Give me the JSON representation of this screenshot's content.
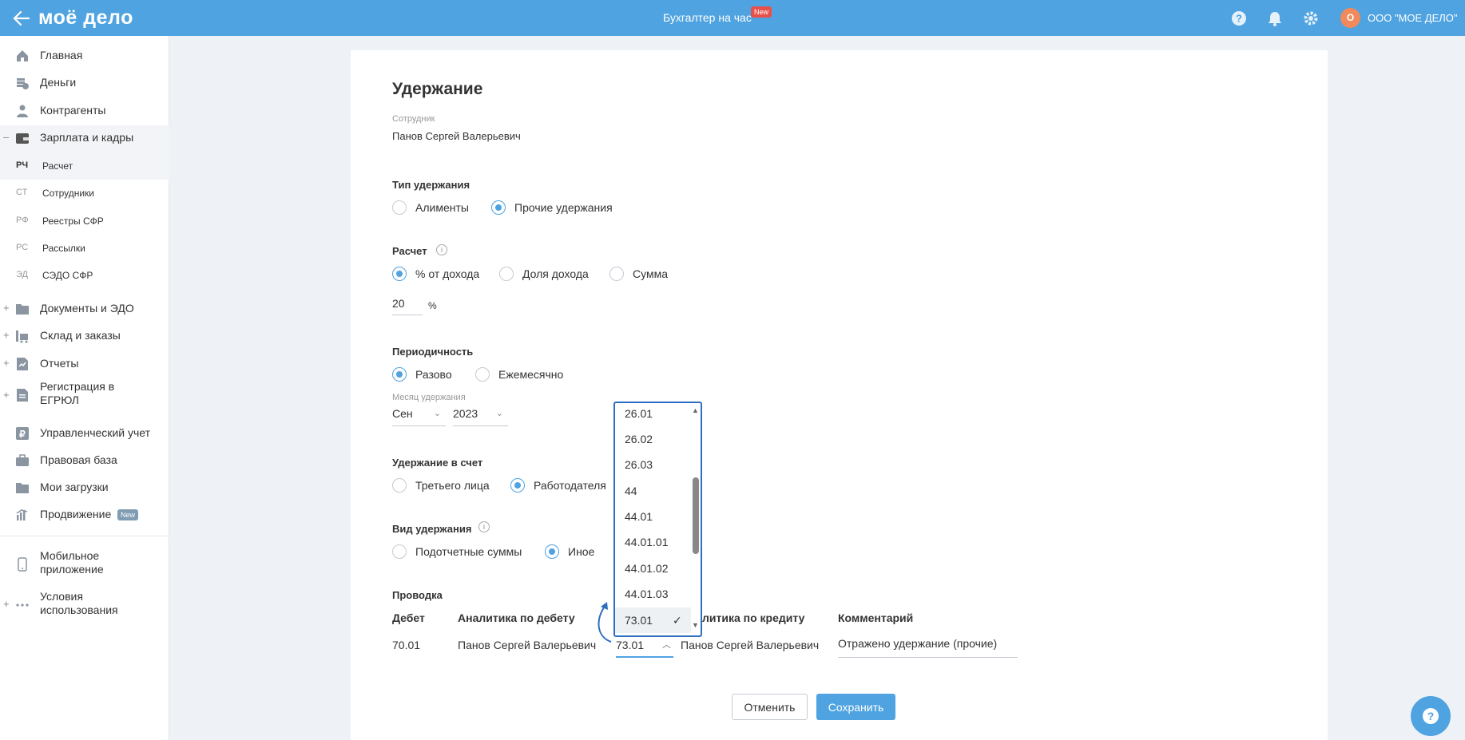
{
  "topbar": {
    "logo": "моё дело",
    "center_title": "Бухгалтер на час",
    "center_badge": "New",
    "org_avatar": "О",
    "org_name": "ООО \"МОЕ ДЕЛО\""
  },
  "sidebar": {
    "items": [
      {
        "label": "Главная",
        "icon": "home-icon"
      },
      {
        "label": "Деньги",
        "icon": "money-icon"
      },
      {
        "label": "Контрагенты",
        "icon": "contractors-icon"
      },
      {
        "label": "Зарплата и кадры",
        "icon": "wallet-icon",
        "toggle": "–"
      },
      {
        "label": "Документы и ЭДО",
        "icon": "folder-icon",
        "toggle": "+"
      },
      {
        "label": "Склад и заказы",
        "icon": "warehouse-icon",
        "toggle": "+"
      },
      {
        "label": "Отчеты",
        "icon": "report-icon",
        "toggle": "+"
      },
      {
        "label": "Регистрация в ЕГРЮЛ",
        "icon": "registration-icon",
        "toggle": "+"
      },
      {
        "label": "Управленческий учет",
        "icon": "management-icon"
      },
      {
        "label": "Правовая база",
        "icon": "briefcase-icon"
      },
      {
        "label": "Мои загрузки",
        "icon": "downloads-icon"
      },
      {
        "label": "Продвижение",
        "icon": "promotion-icon",
        "badge": "New"
      },
      {
        "label": "Мобильное приложение",
        "icon": "mobile-icon"
      },
      {
        "label": "Условия использования",
        "icon": "more-icon",
        "toggle": "+"
      }
    ],
    "subitems": [
      {
        "code": "РЧ",
        "label": "Расчет"
      },
      {
        "code": "СТ",
        "label": "Сотрудники"
      },
      {
        "code": "РФ",
        "label": "Реестры СФР"
      },
      {
        "code": "РС",
        "label": "Рассылки"
      },
      {
        "code": "ЭД",
        "label": "СЭДО СФР"
      }
    ]
  },
  "form": {
    "title": "Удержание",
    "employee_label": "Сотрудник",
    "employee_value": "Панов Сергей Валерьевич",
    "type_title": "Тип удержания",
    "type_options": [
      "Алименты",
      "Прочие удержания"
    ],
    "calc_title": "Расчет",
    "calc_options": [
      "% от дохода",
      "Доля дохода",
      "Сумма"
    ],
    "calc_value": "20",
    "calc_unit": "%",
    "period_title": "Периодичность",
    "period_options": [
      "Разово",
      "Ежемесячно"
    ],
    "month_label": "Месяц удержания",
    "month_value": "Сен",
    "year_value": "2023",
    "account_title": "Удержание в счет",
    "account_options": [
      "Третьего лица",
      "Работодателя"
    ],
    "kind_title": "Вид удержания",
    "kind_options": [
      "Подотчетные суммы",
      "Иное"
    ],
    "posting_title": "Проводка",
    "table_headers": {
      "debit": "Дебет",
      "debit_analytics": "Аналитика по дебету",
      "credit_analytics": "литика по кредиту",
      "comment": "Комментарий"
    },
    "row": {
      "debit": "70.01",
      "debit_analytics": "Панов Сергей Валерьевич",
      "credit": "73.01",
      "credit_analytics": "Панов Сергей Валерьевич",
      "comment": "Отражено удержание (прочие)"
    },
    "cancel_label": "Отменить",
    "save_label": "Сохранить"
  },
  "dropdown": {
    "options": [
      "26.01",
      "26.02",
      "26.03",
      "44",
      "44.01",
      "44.01.01",
      "44.01.02",
      "44.01.03",
      "73.01"
    ],
    "selected": "73.01"
  },
  "colors": {
    "accent": "#4fa3e0",
    "dropdown_border": "#2f6fbf",
    "badge_red": "#e8504b"
  }
}
